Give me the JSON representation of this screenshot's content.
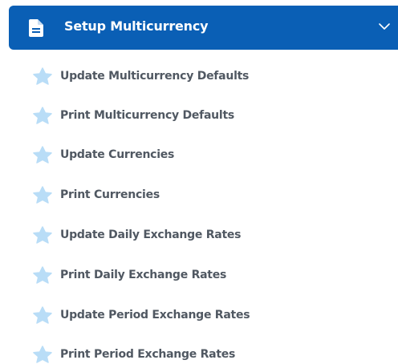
{
  "header": {
    "title": "Setup Multicurrency",
    "icon": "document-icon",
    "chevron": "chevron-down-icon",
    "background_color": "#0a5fb5"
  },
  "items": [
    {
      "label": "Update Multicurrency Defaults",
      "icon": "star-icon"
    },
    {
      "label": "Print Multicurrency Defaults",
      "icon": "star-icon"
    },
    {
      "label": "Update Currencies",
      "icon": "star-icon"
    },
    {
      "label": "Print Currencies",
      "icon": "star-icon"
    },
    {
      "label": "Update Daily Exchange Rates",
      "icon": "star-icon"
    },
    {
      "label": "Print Daily Exchange Rates",
      "icon": "star-icon"
    },
    {
      "label": "Update Period Exchange Rates",
      "icon": "star-icon"
    },
    {
      "label": "Print Period Exchange Rates",
      "icon": "star-icon"
    }
  ],
  "colors": {
    "star": "#b9ddf7",
    "item_text": "#505862"
  }
}
